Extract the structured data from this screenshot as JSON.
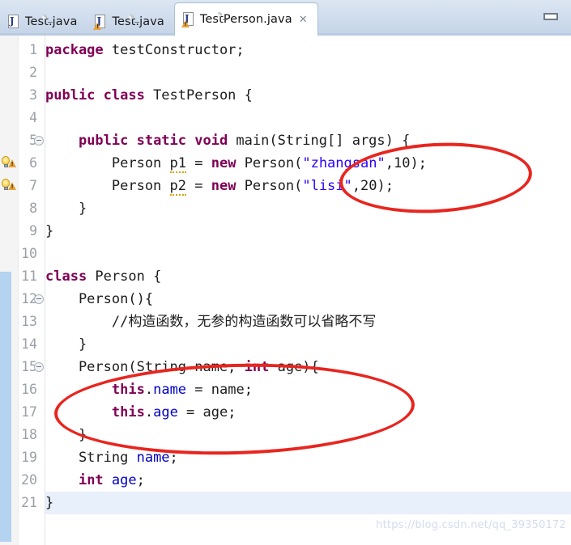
{
  "window": {
    "minimize_label": "Minimize",
    "minimize_icon": "minimize-icon"
  },
  "tabs": [
    {
      "label": "Test.java",
      "icon": "java-file-icon",
      "active": false,
      "has_warning": false,
      "closable": false
    },
    {
      "label": "Test.java",
      "icon": "java-file-warning-icon",
      "active": false,
      "has_warning": true,
      "closable": false
    },
    {
      "label": "TestPerson.java",
      "icon": "java-file-warning-icon",
      "active": true,
      "has_warning": true,
      "closable": true,
      "close_glyph": "✕"
    }
  ],
  "editor": {
    "current_line": 21,
    "selection_bar_lines": [
      11,
      21
    ],
    "fold_marker_lines": [
      5,
      12,
      15
    ],
    "warning_marker_lines": [
      6,
      7
    ],
    "warning_marker_icon": "quick-fix-warning-icon",
    "lines": [
      {
        "n": "1",
        "text": "package testConstructor;"
      },
      {
        "n": "2",
        "text": ""
      },
      {
        "n": "3",
        "text": "public class TestPerson {"
      },
      {
        "n": "4",
        "text": ""
      },
      {
        "n": "5",
        "text": "    public static void main(String[] args) {"
      },
      {
        "n": "6",
        "text": "        Person p1 = new Person(\"zhangsan\",10);"
      },
      {
        "n": "7",
        "text": "        Person p2 = new Person(\"lisi\",20);"
      },
      {
        "n": "8",
        "text": "    }"
      },
      {
        "n": "9",
        "text": "}"
      },
      {
        "n": "10",
        "text": ""
      },
      {
        "n": "11",
        "text": "class Person {"
      },
      {
        "n": "12",
        "text": "    Person(){"
      },
      {
        "n": "13",
        "text": "        //构造函数，无参的构造函数可以省略不写"
      },
      {
        "n": "14",
        "text": "    }"
      },
      {
        "n": "15",
        "text": "    Person(String name, int age){"
      },
      {
        "n": "16",
        "text": "        this.name = name;"
      },
      {
        "n": "17",
        "text": "        this.age = age;"
      },
      {
        "n": "18",
        "text": "    }"
      },
      {
        "n": "19",
        "text": "    String name;"
      },
      {
        "n": "20",
        "text": "    int age;"
      },
      {
        "n": "21",
        "text": "}"
      }
    ]
  },
  "annotations": [
    {
      "name": "constructor-args-ellipse",
      "shape": "ellipse",
      "color": "#e8251f"
    },
    {
      "name": "constructor-definition-ellipse",
      "shape": "ellipse",
      "color": "#e8251f"
    }
  ],
  "watermark": {
    "text": "https://blog.csdn.net/qq_39350172"
  },
  "colors": {
    "keyword": "#7f0055",
    "string": "#2a00ff",
    "comment": "#3f7f5f",
    "field": "#0000c0",
    "annotation": "#e8251f",
    "current_line": "#e8f0fb",
    "selection_bar": "#a7cdf0",
    "tabbar": "#cfdced"
  }
}
